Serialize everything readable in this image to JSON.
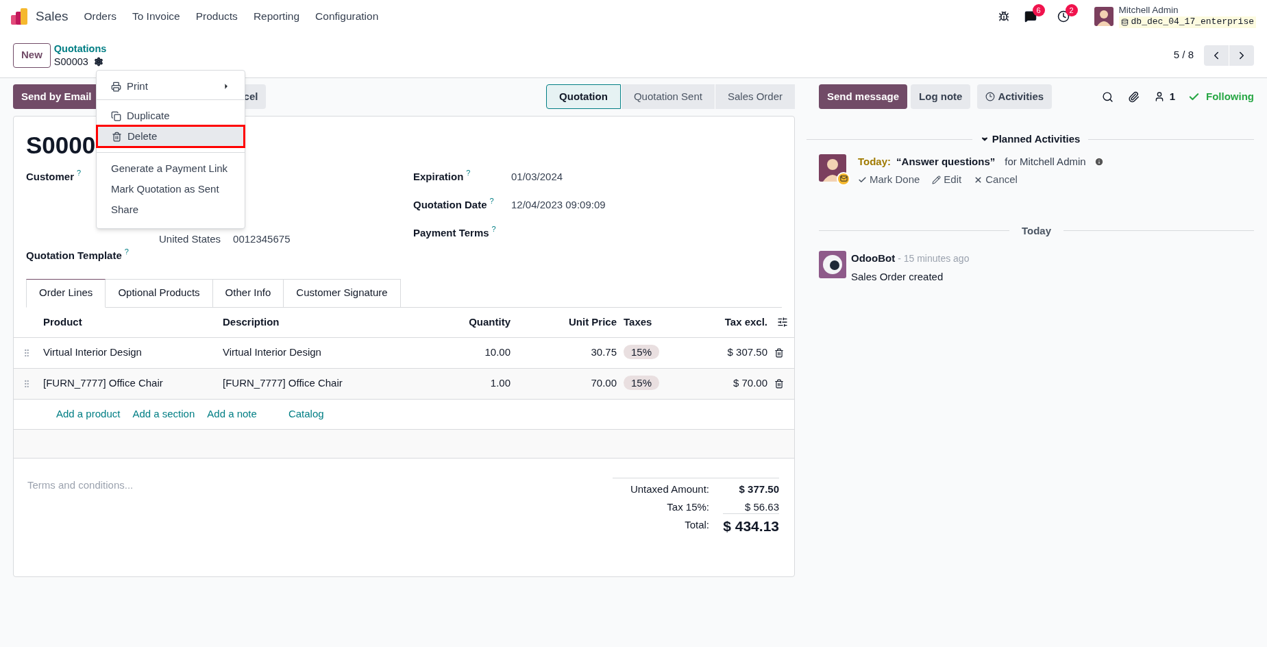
{
  "navbar": {
    "app": "Sales",
    "menu": [
      "Orders",
      "To Invoice",
      "Products",
      "Reporting",
      "Configuration"
    ],
    "message_count": "6",
    "activity_count": "2",
    "user": "Mitchell Admin",
    "database": "db_dec_04_17_enterprise"
  },
  "breadcrumb": {
    "new_button": "New",
    "parent": "Quotations",
    "current": "S00003"
  },
  "pager": "5 / 8",
  "actions": [
    {
      "label": "Send by Email",
      "kind": "primary"
    },
    {
      "label": "cel",
      "kind": "secondary"
    }
  ],
  "statusbar": [
    {
      "label": "Quotation",
      "selected": true
    },
    {
      "label": "Quotation Sent",
      "selected": false
    },
    {
      "label": "Sales Order",
      "selected": false
    }
  ],
  "gear_menu": [
    [
      {
        "label": "Print",
        "kind": "print",
        "selected": false
      }
    ],
    [
      {
        "label": "Duplicate",
        "kind": "duplicate",
        "selected": false
      },
      {
        "label": "Delete",
        "kind": "delete",
        "selected": true
      }
    ],
    [
      {
        "label": "Generate a Payment Link",
        "kind": "plain",
        "selected": false
      },
      {
        "label": "Mark Quotation as Sent",
        "kind": "plain",
        "selected": false
      },
      {
        "label": "Share",
        "kind": "plain",
        "selected": false
      }
    ]
  ],
  "sheet": {
    "title": "S0000",
    "customer": {
      "label": "Customer",
      "help": "?",
      "address": [
        "United States",
        "0012345675"
      ]
    },
    "template": {
      "label": "Quotation Template",
      "help": "?"
    },
    "fields_right": [
      {
        "label": "Expiration",
        "help": "?",
        "value": "01/03/2024"
      },
      {
        "label": "Quotation Date",
        "help": "?",
        "value": "12/04/2023 09:09:09"
      },
      {
        "label": "Payment Terms",
        "help": "?"
      }
    ],
    "tabs": [
      {
        "label": "Order Lines",
        "selected": true
      },
      {
        "label": "Optional Products",
        "selected": false
      },
      {
        "label": "Other Info",
        "selected": false
      },
      {
        "label": "Customer Signature",
        "selected": false
      }
    ],
    "table": {
      "columns": [
        "Product",
        "Description",
        "Quantity",
        "Unit Price",
        "Taxes",
        "Tax excl."
      ],
      "rows": [
        {
          "product": "Virtual Interior Design",
          "description": "Virtual Interior Design",
          "quantity": "10.00",
          "unit_price": "30.75",
          "taxes": "15%",
          "subtotal": "$ 307.50"
        },
        {
          "product": "[FURN_7777] Office Chair",
          "description": "[FURN_7777] Office Chair",
          "quantity": "1.00",
          "unit_price": "70.00",
          "taxes": "15%",
          "subtotal": "$ 70.00"
        }
      ],
      "add_links": [
        "Add a product",
        "Add a section",
        "Add a note",
        "Catalog"
      ]
    },
    "terms_placeholder": "Terms and conditions...",
    "totals": [
      {
        "label": "Untaxed Amount:",
        "value": "$ 377.50",
        "kind": "bold"
      },
      {
        "label": "Tax 15%:",
        "value": "$ 56.63",
        "kind": "normal"
      },
      {
        "label": "Total:",
        "value": "$ 434.13",
        "kind": "total"
      }
    ]
  },
  "chatter": {
    "buttons": [
      {
        "label": "Send message",
        "kind": "primary"
      },
      {
        "label": "Log note",
        "kind": "secondary"
      },
      {
        "label": "Activities",
        "kind": "activities"
      }
    ],
    "follower_count": "1",
    "following": "Following",
    "planned_heading": "Planned Activities",
    "activity": {
      "due": "Today:",
      "summary": "“Answer questions”",
      "assignee": "for Mitchell Admin",
      "actions": [
        {
          "label": "Mark Done",
          "kind": "done"
        },
        {
          "label": "Edit",
          "kind": "edit"
        },
        {
          "label": "Cancel",
          "kind": "cancel"
        }
      ]
    },
    "day_separator": "Today",
    "message": {
      "author": "OdooBot",
      "time": "- 15 minutes ago",
      "body": "Sales Order created"
    }
  }
}
